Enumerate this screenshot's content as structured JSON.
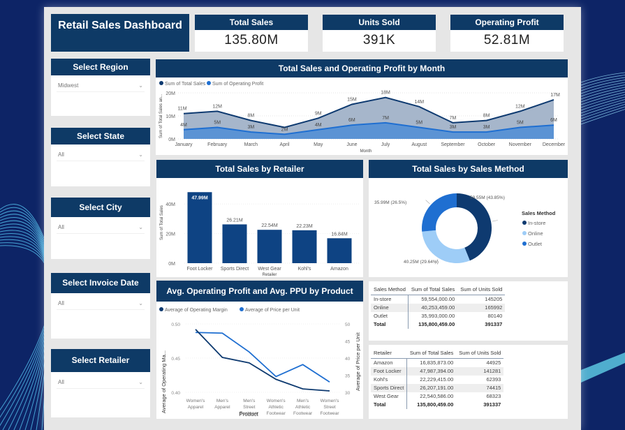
{
  "colors": {
    "navy": "#0e3a66",
    "canvas": "#e6e6e6",
    "series_dark": "#0e3a70",
    "series_blue": "#1f6fd1",
    "online": "#9ecdf7",
    "background": "#0d2466"
  },
  "header": {
    "title": "Retail Sales Dashboard"
  },
  "kpis": [
    {
      "label": "Total Sales",
      "value": "135.80M"
    },
    {
      "label": "Units Sold",
      "value": "391K"
    },
    {
      "label": "Operating Profit",
      "value": "52.81M"
    }
  ],
  "slicers": [
    {
      "label": "Select Region",
      "value": "Midwest"
    },
    {
      "label": "Select State",
      "value": "All"
    },
    {
      "label": "Select City",
      "value": "All"
    },
    {
      "label": "Select Invoice Date",
      "value": "All"
    },
    {
      "label": "Select Retailer",
      "value": "All"
    }
  ],
  "icons": {
    "dropdown": "chevron-down-icon"
  },
  "chart_data": [
    {
      "id": "monthly",
      "type": "area",
      "title": "Total Sales and Operating Profit by Month",
      "xlabel": "Month",
      "ylabel": "Sum of Total Sales an...",
      "categories": [
        "January",
        "February",
        "March",
        "April",
        "May",
        "June",
        "July",
        "August",
        "September",
        "October",
        "November",
        "December"
      ],
      "series": [
        {
          "name": "Sum of Total Sales",
          "values": [
            11,
            12,
            8,
            5,
            9,
            15,
            18,
            14,
            7,
            8,
            12,
            17
          ],
          "labels": [
            "11M",
            "12M",
            "8M",
            "",
            "9M",
            "15M",
            "18M",
            "14M",
            "7M",
            "8M",
            "12M",
            "17M"
          ]
        },
        {
          "name": "Sum of Operating Profit",
          "values": [
            4,
            5,
            3,
            2,
            4,
            6,
            7,
            5,
            3,
            3,
            5,
            6
          ],
          "labels": [
            "4M",
            "5M",
            "3M",
            "2M",
            "4M",
            "6M",
            "7M",
            "5M",
            "3M",
            "3M",
            "5M",
            "6M"
          ]
        }
      ],
      "yticks": [
        "0M",
        "10M",
        "20M"
      ],
      "ylim": [
        0,
        20
      ],
      "legend": "top-left",
      "grid": true
    },
    {
      "id": "retailer",
      "type": "bar",
      "title": "Total Sales by Retailer",
      "xlabel": "Retailer",
      "ylabel": "Sum of Total Sales",
      "categories": [
        "Foot Locker",
        "Sports Direct",
        "West Gear",
        "Kohl's",
        "Amazon"
      ],
      "values": [
        47.99,
        26.21,
        22.54,
        22.23,
        16.84
      ],
      "labels": [
        "47.99M",
        "26.21M",
        "22.54M",
        "22.23M",
        "16.84M"
      ],
      "yticks": [
        "0M",
        "20M",
        "40M"
      ],
      "ylim": [
        0,
        50
      ],
      "grid": true
    },
    {
      "id": "method",
      "type": "pie",
      "title": "Total Sales by Sales Method",
      "legend_title": "Sales Method",
      "legend": "right",
      "slices": [
        {
          "name": "In-store",
          "value": 59.55,
          "label": "59.55M (43.85%)",
          "color": "#0e3a70"
        },
        {
          "name": "Online",
          "value": 40.25,
          "label": "40.25M (29.64%)",
          "color": "#9ecdf7"
        },
        {
          "name": "Outlet",
          "value": 35.99,
          "label": "35.99M (26.5%)",
          "color": "#1f6fd1"
        }
      ]
    },
    {
      "id": "product",
      "type": "line",
      "title": "Avg. Operating Profit and Avg. PPU by Product",
      "xlabel": "Product",
      "ylabel_left": "Average of Operating Ma...",
      "ylabel_right": "Average of Price per Unit",
      "categories": [
        [
          "Women's",
          "Apparel"
        ],
        [
          "Men's",
          "Apparel"
        ],
        [
          "Men's",
          "Street",
          "Footwear"
        ],
        [
          "Women's",
          "Athletic",
          "Footwear"
        ],
        [
          "Men's",
          "Athletic",
          "Footwear"
        ],
        [
          "Women's",
          "Street",
          "Footwear"
        ]
      ],
      "series": [
        {
          "name": "Average of Operating Margin",
          "axis": "left",
          "values": [
            0.492,
            0.451,
            0.443,
            0.419,
            0.405,
            0.402
          ]
        },
        {
          "name": "Average of Price per Unit",
          "axis": "right",
          "values": [
            47.5,
            47.3,
            41.8,
            34.6,
            38.1,
            33.0
          ]
        }
      ],
      "yticks_left": [
        "0.40",
        "0.45",
        "0.50"
      ],
      "ylim_left": [
        0.4,
        0.5
      ],
      "yticks_right": [
        "30",
        "35",
        "40",
        "45",
        "50"
      ],
      "ylim_right": [
        30,
        50
      ],
      "legend": "top-left"
    }
  ],
  "tables": {
    "sales_method": {
      "headers": [
        "Sales Method",
        "Sum of Total Sales",
        "Sum of Units Sold"
      ],
      "rows": [
        [
          "In-store",
          "59,554,000.00",
          "145205"
        ],
        [
          "Online",
          "40,253,459.00",
          "165992"
        ],
        [
          "Outlet",
          "35,993,000.00",
          "80140"
        ]
      ],
      "total": [
        "Total",
        "135,800,459.00",
        "391337"
      ]
    },
    "retailer": {
      "headers": [
        "Retailer",
        "Sum of Total Sales",
        "Sum of Units Sold"
      ],
      "rows": [
        [
          "Amazon",
          "16,835,873.00",
          "44925"
        ],
        [
          "Foot Locker",
          "47,987,394.00",
          "141281"
        ],
        [
          "Kohl's",
          "22,229,415.00",
          "62393"
        ],
        [
          "Sports Direct",
          "26,207,191.00",
          "74415"
        ],
        [
          "West Gear",
          "22,540,586.00",
          "68323"
        ]
      ],
      "total": [
        "Total",
        "135,800,459.00",
        "391337"
      ]
    }
  }
}
